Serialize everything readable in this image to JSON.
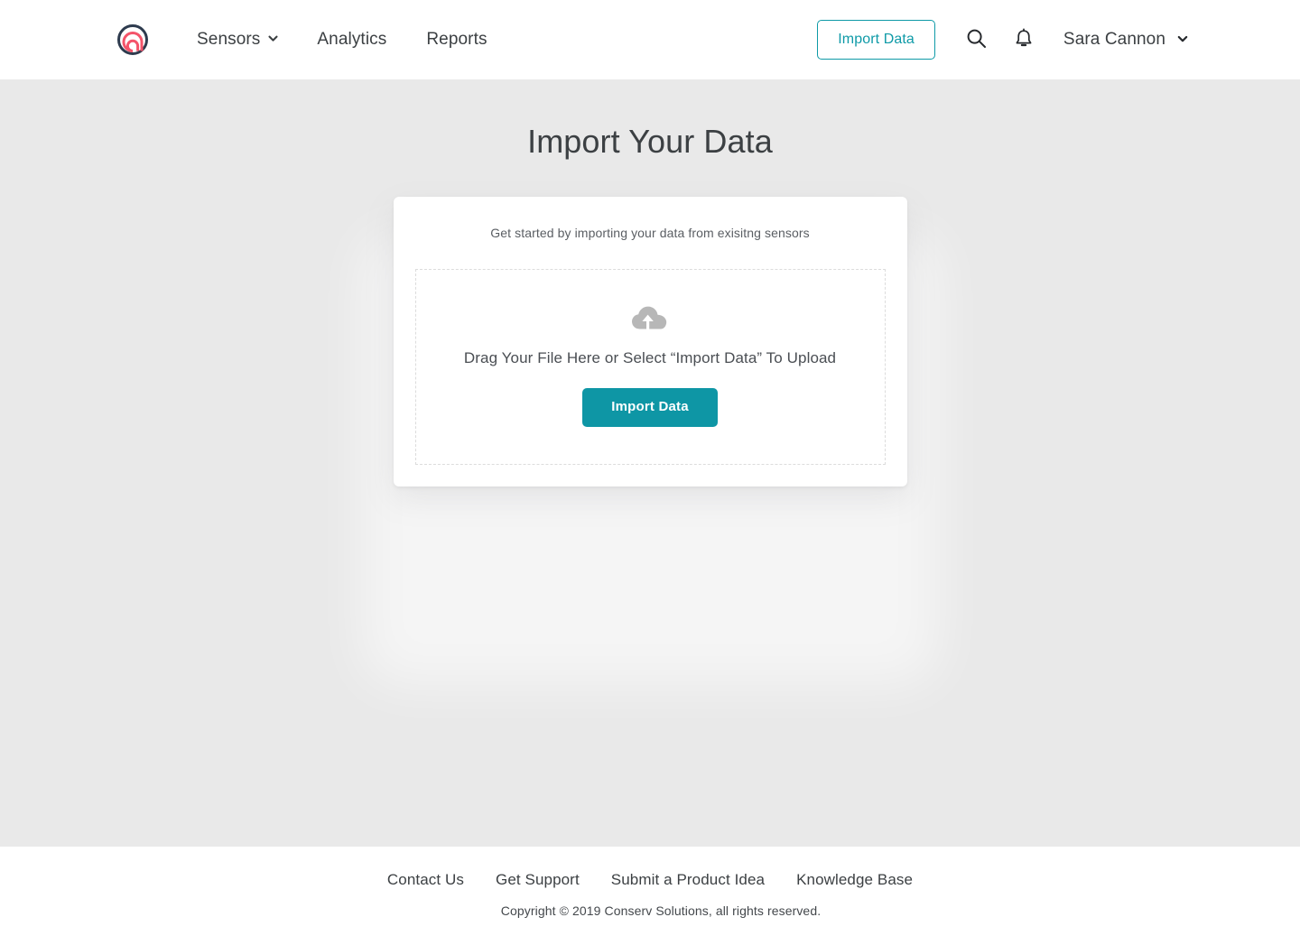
{
  "navbar": {
    "logo_name": "conserv-logo",
    "logo_ring_color": "#2e3b4e",
    "logo_spiral_color": "#f4546a",
    "links": [
      {
        "label": "Sensors",
        "has_dropdown": true
      },
      {
        "label": "Analytics",
        "has_dropdown": false
      },
      {
        "label": "Reports",
        "has_dropdown": false
      }
    ],
    "import_button": "Import Data",
    "search_icon": "search-icon",
    "bell_icon": "bell-icon",
    "user": "Sara Cannon",
    "user_chevron": "chevron-down-icon",
    "accent_color": "#0e9aa7"
  },
  "main": {
    "title": "Import Your Data",
    "background_color": "#e9e9e9",
    "card": {
      "subtitle": "Get started by importing your data from exisitng sensors",
      "dropzone_icon": "cloud-upload-icon",
      "dropzone_text": "Drag Your File Here or Select “Import Data” To Upload",
      "import_button": "Import Data",
      "button_color": "#0e96a5"
    }
  },
  "footer": {
    "links": [
      "Contact Us",
      "Get Support",
      "Submit a Product Idea",
      "Knowledge Base"
    ],
    "copyright": "Copyright © 2019 Conserv Solutions, all rights reserved."
  }
}
